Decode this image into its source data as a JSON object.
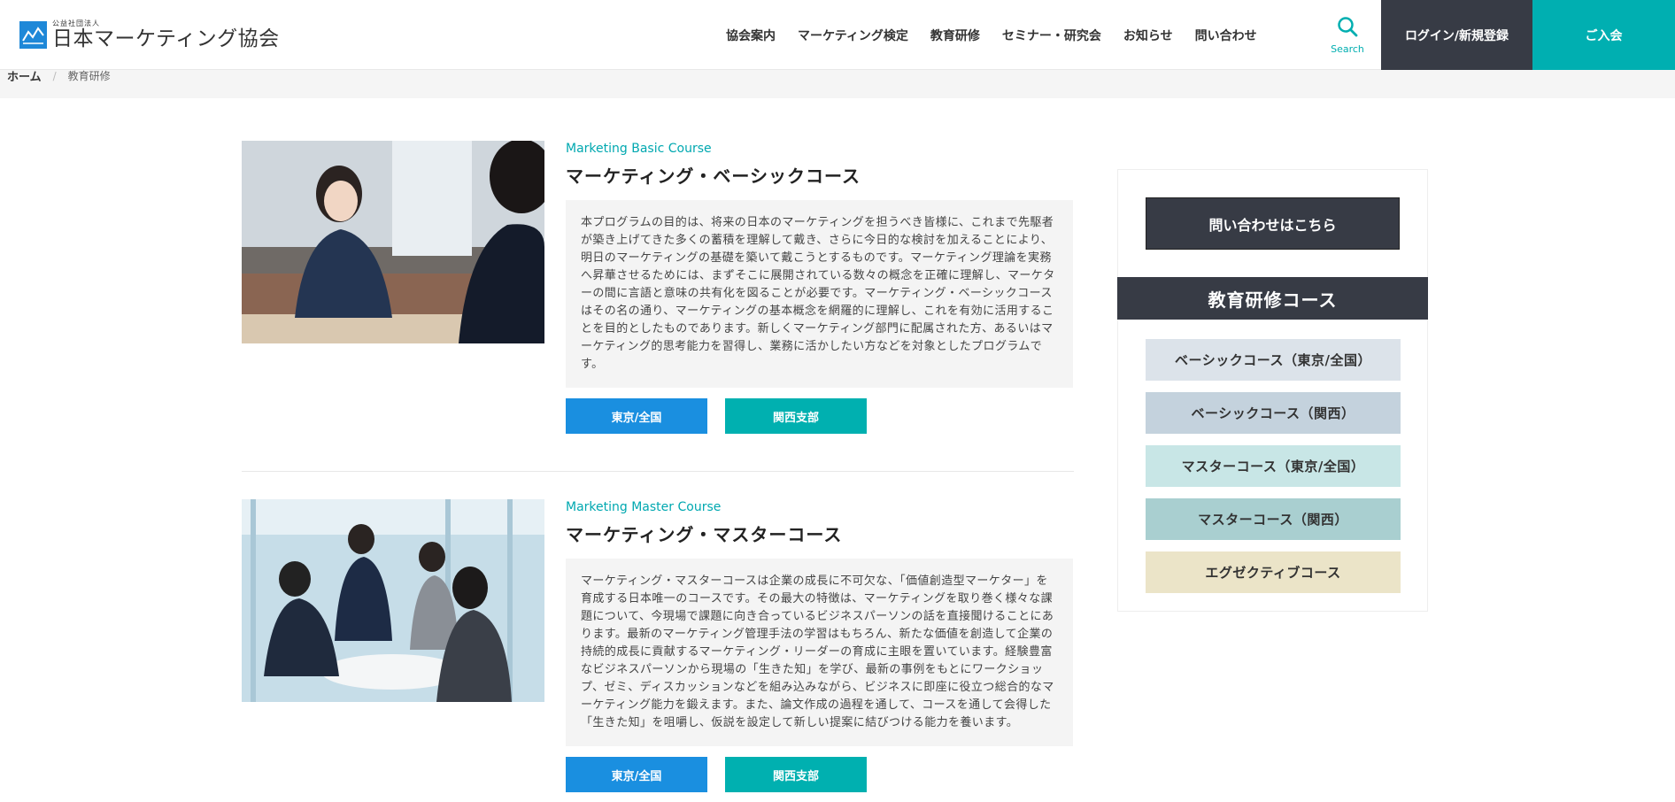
{
  "header": {
    "logo_sub": "公益社団法人",
    "logo_main": "日本マーケティング協会",
    "nav": [
      {
        "label": "協会案内"
      },
      {
        "label": "マーケティング検定"
      },
      {
        "label": "教育研修"
      },
      {
        "label": "セミナー・研究会"
      },
      {
        "label": "お知らせ"
      },
      {
        "label": "問い合わせ"
      }
    ],
    "search_label": "Search",
    "login_label": "ログイン/新規登録",
    "join_label": "ご入会"
  },
  "breadcrumb": {
    "home": "ホーム",
    "separator": "/",
    "current": "教育研修"
  },
  "courses": [
    {
      "en": "Marketing Basic Course",
      "ja": "マーケティング・ベーシックコース",
      "description": "本プログラムの目的は、将来の日本のマーケティングを担うべき皆様に、これまで先駆者が築き上げてきた多くの蓄積を理解して戴き、さらに今日的な検討を加えることにより、明日のマーケティングの基礎を築いて戴こうとするものです。マーケティング理論を実務へ昇華させるためには、まずそこに展開されている数々の概念を正確に理解し、マーケターの間に言語と意味の共有化を図ることが必要です。マーケティング・ベーシックコースはその名の通り、マーケティングの基本概念を網羅的に理解し、これを有効に活用することを目的としたものであります。新しくマーケティング部門に配属された方、あるいはマーケティング的思考能力を習得し、業務に活かしたい方などを対象としたプログラムです。",
      "btn_tokyo": "東京/全国",
      "btn_kansai": "関西支部"
    },
    {
      "en": "Marketing Master Course",
      "ja": "マーケティング・マスターコース",
      "description": "マーケティング・マスターコースは企業の成長に不可欠な、「価値創造型マーケター」を育成する日本唯一のコースです。その最大の特徴は、マーケティングを取り巻く様々な課題について、今現場で課題に向き合っているビジネスパーソンの話を直接聞けることにあります。最新のマーケティング管理手法の学習はもちろん、新たな価値を創造して企業の持続的成長に貢献するマーケティング・リーダーの育成に主眼を置いています。経験豊富なビジネスパーソンから現場の「生きた知」を学び、最新の事例をもとにワークショップ、ゼミ、ディスカッションなどを組み込みながら、ビジネスに即座に役立つ総合的なマーケティング能力を鍛えます。また、論文作成の過程を通して、コースを通して会得した「生きた知」を咀嚼し、仮説を設定して新しい提案に結びつける能力を養います。",
      "btn_tokyo": "東京/全国",
      "btn_kansai": "関西支部"
    }
  ],
  "sidebar": {
    "contact_label": "問い合わせはこちら",
    "heading": "教育研修コース",
    "links": [
      {
        "label": "ベーシックコース（東京/全国）",
        "color": "#dce3ea"
      },
      {
        "label": "ベーシックコース（関西）",
        "color": "#c4d2dd"
      },
      {
        "label": "マスターコース（東京/全国）",
        "color": "#c8e6e6"
      },
      {
        "label": "マスターコース（関西）",
        "color": "#a9cfd0"
      },
      {
        "label": "エグゼクティブコース",
        "color": "#ebe4c8"
      }
    ]
  },
  "colors": {
    "accent_teal": "#00afb1",
    "accent_blue": "#1a8fe0",
    "dark": "#373b45"
  },
  "icons": {
    "logo": "mountain-logo-icon",
    "search": "search-icon"
  }
}
